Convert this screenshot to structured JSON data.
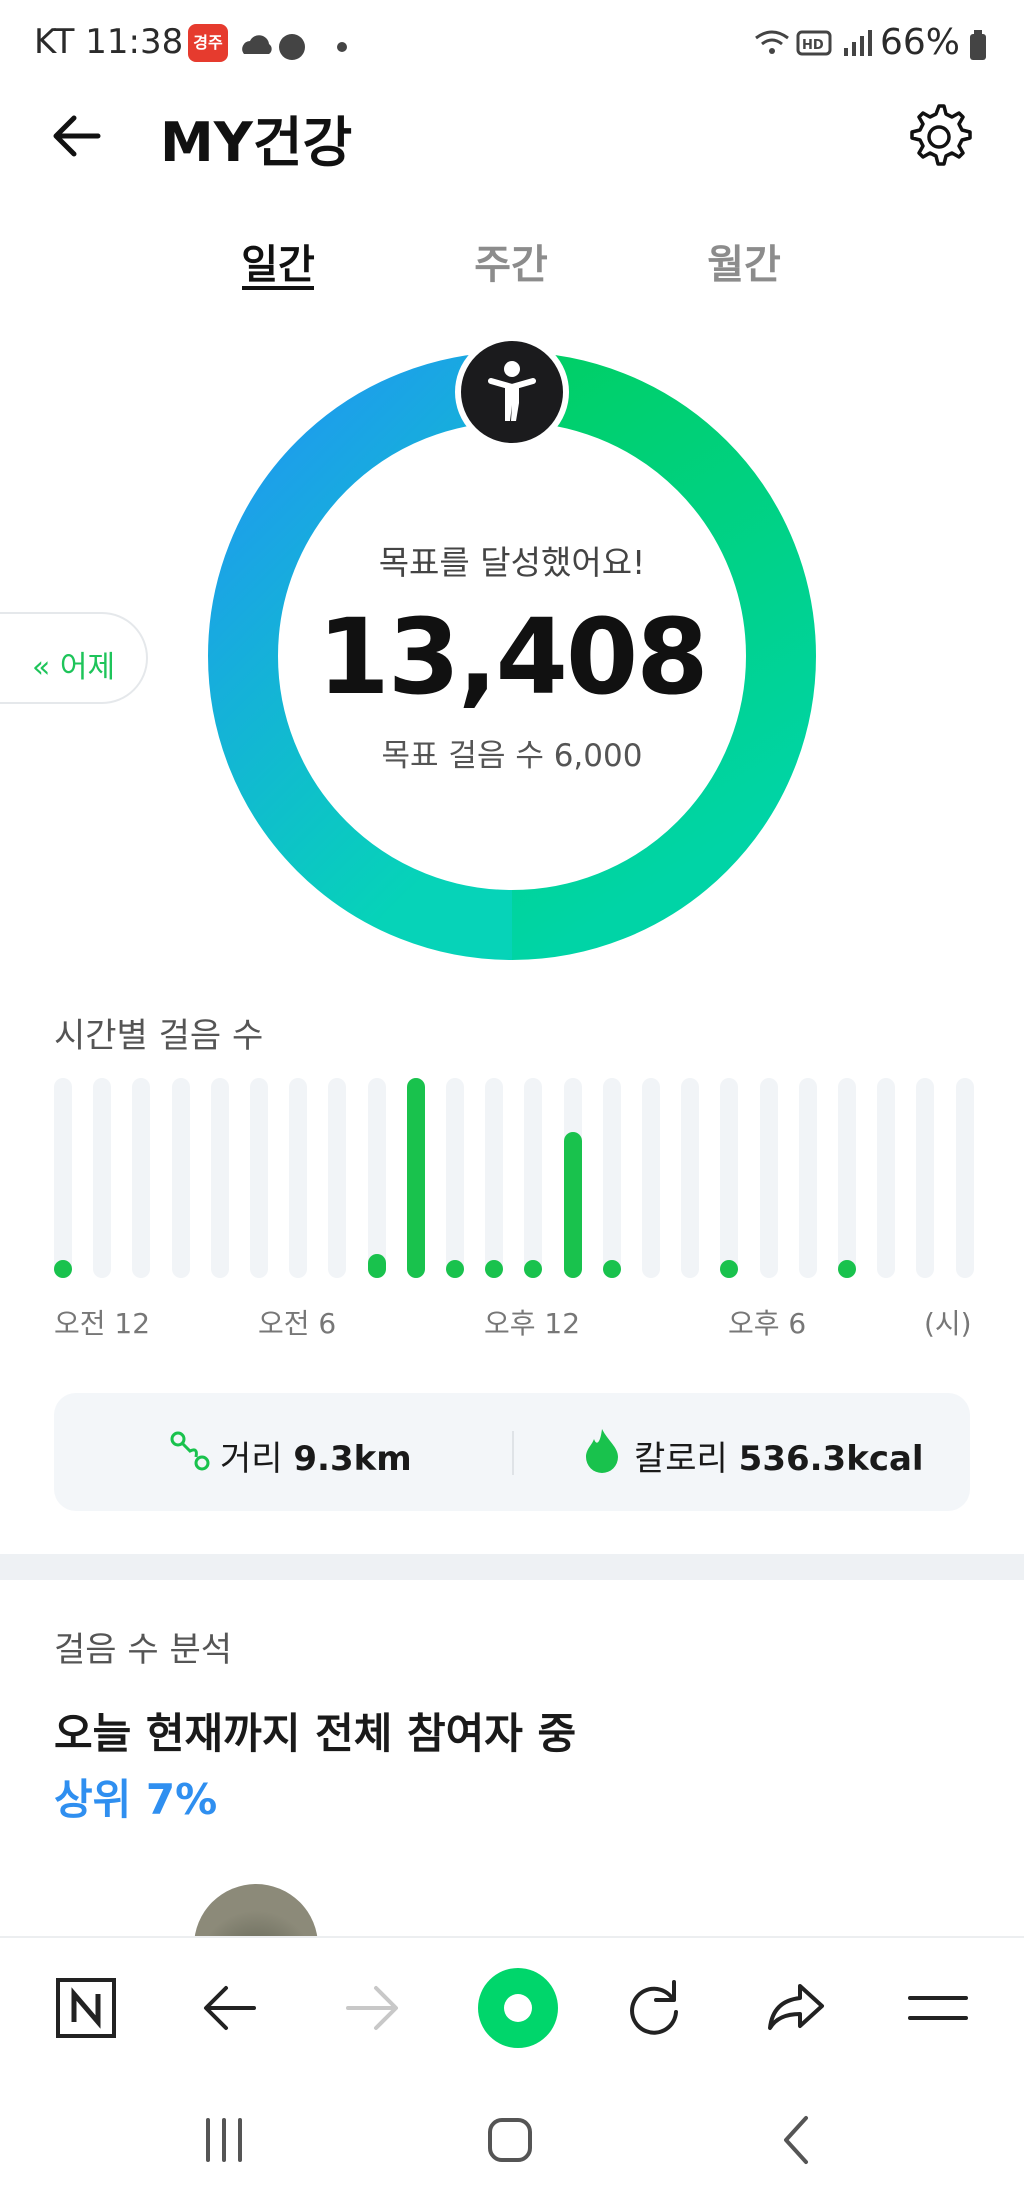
{
  "status_bar": {
    "carrier_time": "KT 11:38",
    "badge": "경주",
    "battery": "66%"
  },
  "header": {
    "title": "MY건강",
    "back_icon": "arrow-left-icon",
    "settings_icon": "gear-icon"
  },
  "tabs": [
    {
      "label": "일간",
      "active": true
    },
    {
      "label": "주간",
      "active": false
    },
    {
      "label": "월간",
      "active": false
    }
  ],
  "summary": {
    "goal_message": "목표를 달성했어요!",
    "steps": "13,408",
    "goal_steps": "목표 걸음 수 6,000",
    "progress_percent": 100,
    "yesterday_label": "« 어제",
    "walker_icon": "person-walking-icon"
  },
  "hourly": {
    "label": "시간별 걸음 수",
    "ticks": [
      "오전 12",
      "오전 6",
      "오후 12",
      "오후 6",
      "(시)"
    ]
  },
  "chart_data": {
    "type": "bar",
    "title": "시간별 걸음 수",
    "categories": [
      "0",
      "1",
      "2",
      "3",
      "4",
      "5",
      "6",
      "7",
      "8",
      "9",
      "10",
      "11",
      "12",
      "13",
      "14",
      "15",
      "16",
      "17",
      "18",
      "19",
      "20",
      "21",
      "22",
      "23"
    ],
    "values": [
      1,
      0,
      0,
      0,
      0,
      0,
      0,
      0,
      12,
      100,
      5,
      8,
      8,
      73,
      1,
      0,
      0,
      1,
      0,
      0,
      4,
      0,
      0,
      0
    ],
    "ylim": [
      0,
      100
    ],
    "colors": {
      "bar": "#19c24d",
      "track": "#f1f4f7"
    }
  },
  "stats": {
    "distance_label": "거리",
    "distance_value": "9.3km",
    "calorie_label": "칼로리",
    "calorie_value": "536.3kcal"
  },
  "analysis": {
    "label": "걸음 수 분석",
    "title": "오늘 현재까지 전체 참여자 중",
    "rank": "상위 7%"
  },
  "toolbar": {
    "items": [
      "naver-n-icon",
      "back-arrow-icon",
      "forward-arrow-icon",
      "home-green-icon",
      "refresh-icon",
      "share-icon",
      "menu-icon"
    ]
  },
  "colors": {
    "accent_green": "#19c24d",
    "accent_blue": "#2f8ff0",
    "ring_blue": "#2196f3",
    "ring_green": "#00cf67"
  }
}
